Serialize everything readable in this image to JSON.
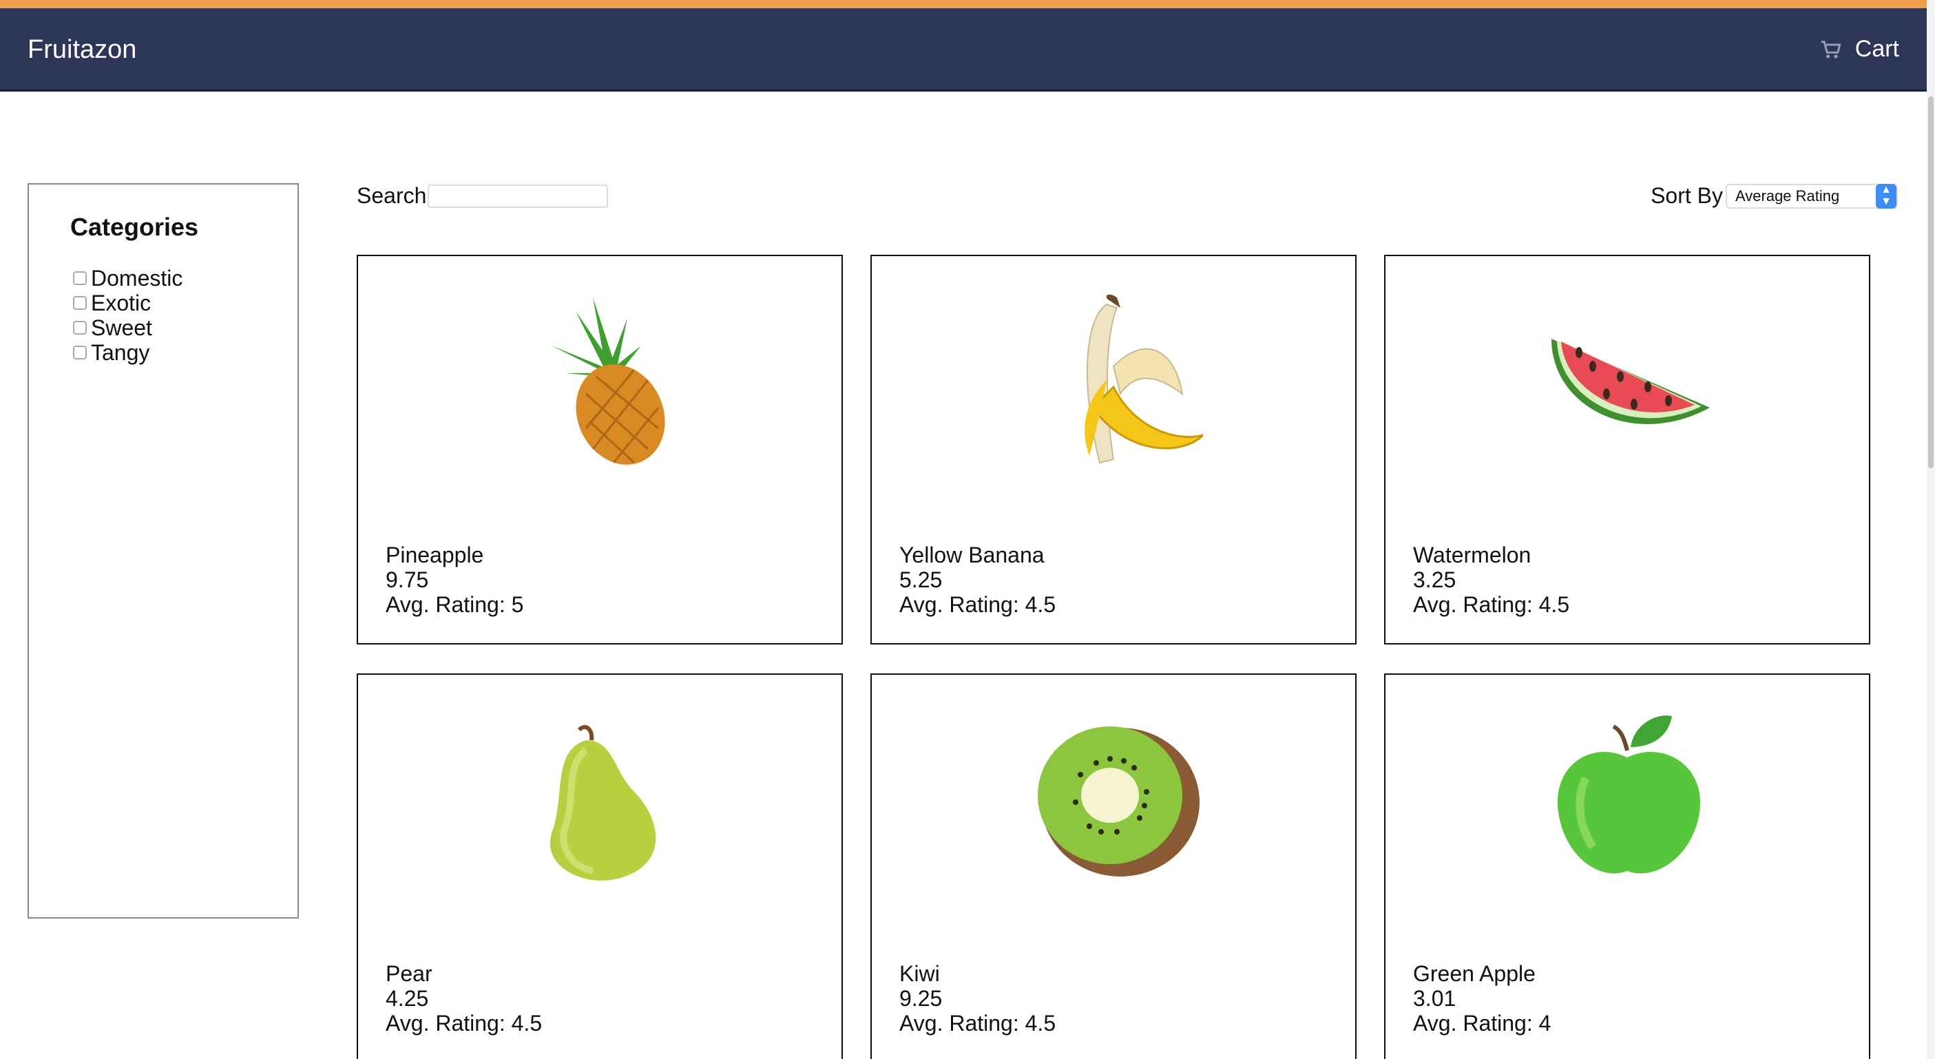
{
  "app": {
    "brand": "Fruitazon",
    "cart_label": "Cart",
    "accent_color": "#f0a04b",
    "nav_color": "#2e3658"
  },
  "sidebar": {
    "title": "Categories",
    "categories": [
      {
        "label": "Domestic",
        "checked": false
      },
      {
        "label": "Exotic",
        "checked": false
      },
      {
        "label": "Sweet",
        "checked": false
      },
      {
        "label": "Tangy",
        "checked": false
      }
    ]
  },
  "search": {
    "label": "Search",
    "value": "",
    "placeholder": ""
  },
  "sort": {
    "label": "Sort By",
    "selected": "Average Rating"
  },
  "products": [
    {
      "name": "Pineapple",
      "price": "9.75",
      "rating": "Avg. Rating: 5",
      "icon": "pineapple-icon"
    },
    {
      "name": "Yellow Banana",
      "price": "5.25",
      "rating": "Avg. Rating: 4.5",
      "icon": "banana-icon"
    },
    {
      "name": "Watermelon",
      "price": "3.25",
      "rating": "Avg. Rating: 4.5",
      "icon": "watermelon-icon"
    },
    {
      "name": "Pear",
      "price": "4.25",
      "rating": "Avg. Rating: 4.5",
      "icon": "pear-icon"
    },
    {
      "name": "Kiwi",
      "price": "9.25",
      "rating": "Avg. Rating: 4.5",
      "icon": "kiwi-icon"
    },
    {
      "name": "Green Apple",
      "price": "3.01",
      "rating": "Avg. Rating: 4",
      "icon": "green-apple-icon"
    }
  ]
}
